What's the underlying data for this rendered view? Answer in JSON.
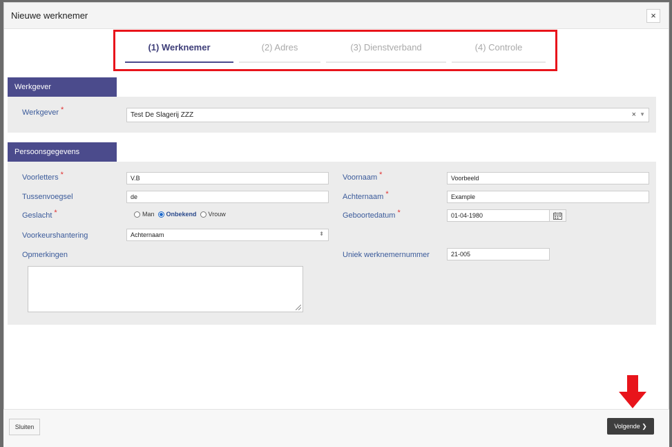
{
  "modal": {
    "title": "Nieuwe werknemer",
    "close_label": "×"
  },
  "steps": [
    {
      "label": "(1) Werknemer",
      "active": true
    },
    {
      "label": "(2) Adres",
      "active": false
    },
    {
      "label": "(3) Dienstverband",
      "active": false
    },
    {
      "label": "(4) Controle",
      "active": false
    }
  ],
  "werkgever_section": {
    "tab_label": "Werkgever",
    "field_label": "Werkgever",
    "required_mark": "*",
    "value": "Test De Slagerij ZZZ",
    "clear_label": "×",
    "caret": "▼"
  },
  "persoon_section": {
    "tab_label": "Persoonsgegevens",
    "voorletters": {
      "label": "Voorletters",
      "value": "V.B"
    },
    "tussenvoegsel": {
      "label": "Tussenvoegsel",
      "value": "de"
    },
    "geslacht": {
      "label": "Geslacht",
      "options": [
        {
          "label": "Man",
          "selected": false
        },
        {
          "label": "Onbekend",
          "selected": true
        },
        {
          "label": "Vrouw",
          "selected": false
        }
      ]
    },
    "voorkeurshantering": {
      "label": "Voorkeurshantering",
      "value": "Achternaam",
      "caret": "⬍"
    },
    "opmerkingen": {
      "label": "Opmerkingen",
      "value": ""
    },
    "voornaam": {
      "label": "Voornaam",
      "value": "Voorbeeld"
    },
    "achternaam": {
      "label": "Achternaam",
      "value": "Example"
    },
    "geboortedatum": {
      "label": "Geboortedatum",
      "value": "01-04-1980"
    },
    "werknemernummer": {
      "label": "Uniek werknemernummer",
      "value": "21-005"
    }
  },
  "footer": {
    "close_label": "Sluiten",
    "next_label": "Volgende ❯"
  },
  "colors": {
    "accent": "#4b4b8c",
    "highlight": "#e8141b",
    "label": "#3a5a9a",
    "required": "#e03131"
  }
}
